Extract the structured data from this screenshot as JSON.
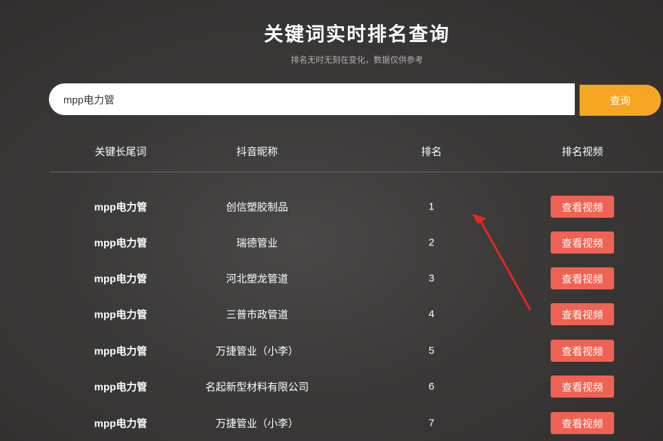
{
  "header": {
    "title": "关键词实时排名查询",
    "subtitle": "排名无时无刻在变化，数据仅供参考"
  },
  "search": {
    "value": "mpp电力管",
    "button_label": "查询"
  },
  "table": {
    "columns": [
      "关键长尾词",
      "抖音昵称",
      "排名",
      "排名视频"
    ],
    "rows": [
      {
        "keyword": "mpp电力管",
        "nickname": "创信塑胶制品",
        "rank": "1",
        "action": "查看视频"
      },
      {
        "keyword": "mpp电力管",
        "nickname": "瑞德管业",
        "rank": "2",
        "action": "查看视频"
      },
      {
        "keyword": "mpp电力管",
        "nickname": "河北塑龙管道",
        "rank": "3",
        "action": "查看视频"
      },
      {
        "keyword": "mpp电力管",
        "nickname": "三普市政管道",
        "rank": "4",
        "action": "查看视频"
      },
      {
        "keyword": "mpp电力管",
        "nickname": "万捷管业（小李）",
        "rank": "5",
        "action": "查看视频"
      },
      {
        "keyword": "mpp电力管",
        "nickname": "名起新型材料有限公司",
        "rank": "6",
        "action": "查看视频"
      },
      {
        "keyword": "mpp电力管",
        "nickname": "万捷管业（小李）",
        "rank": "7",
        "action": "查看视频"
      }
    ]
  },
  "colors": {
    "search_button": "#f5a623",
    "video_button": "#f06253",
    "annotation_arrow": "#e8271f"
  },
  "icons": {
    "annotation": "red-arrow-icon"
  }
}
